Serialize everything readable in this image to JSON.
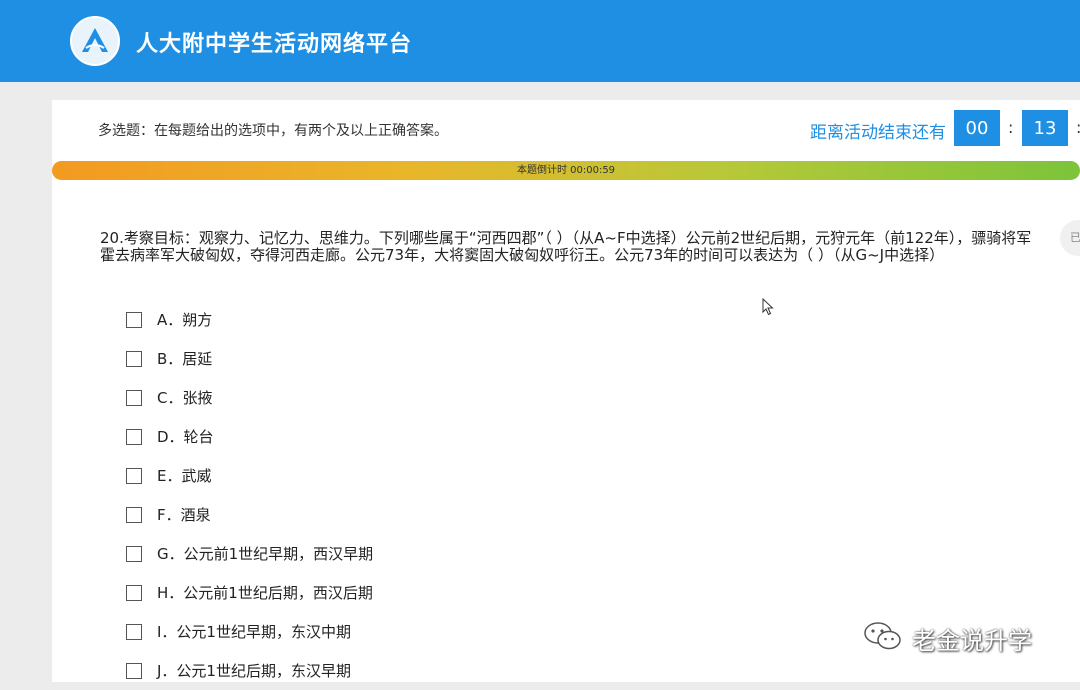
{
  "header": {
    "app_title": "人大附中学生活动网络平台",
    "logo_icon": "school-logo-icon",
    "background_color": "#1f8fe3"
  },
  "instruction_bar": {
    "instruction": "多选题：在每题给出的选项中，有两个及以上正确答案。",
    "countdown_label": "距离活动结束还有",
    "minutes": "00",
    "seconds": "13"
  },
  "progress": {
    "label": "本题倒计时 00:00:59"
  },
  "side_tab": {
    "label": "已"
  },
  "question": {
    "text": "20.考察目标：观察力、记忆力、思维力。下列哪些属于“河西四郡”（ ）（从A~F中选择）公元前2世纪后期，元狩元年（前122年），骠骑将军霍去病率军大破匈奴，夺得河西走廊。公元73年，大将窦固大破匈奴呼衍王。公元73年的时间可以表达为（ ）（从G~J中选择）",
    "options": [
      {
        "label": "A．朔方"
      },
      {
        "label": "B．居延"
      },
      {
        "label": "C．张掖"
      },
      {
        "label": "D．轮台"
      },
      {
        "label": "E．武威"
      },
      {
        "label": "F．酒泉"
      },
      {
        "label": "G．公元前1世纪早期，西汉早期"
      },
      {
        "label": "H．公元前1世纪后期，西汉后期"
      },
      {
        "label": "I．公元1世纪早期，东汉中期"
      },
      {
        "label": "J．公元1世纪后期，东汉早期"
      }
    ]
  },
  "watermark": {
    "text": "老金说升学",
    "icon": "wechat-icon"
  }
}
